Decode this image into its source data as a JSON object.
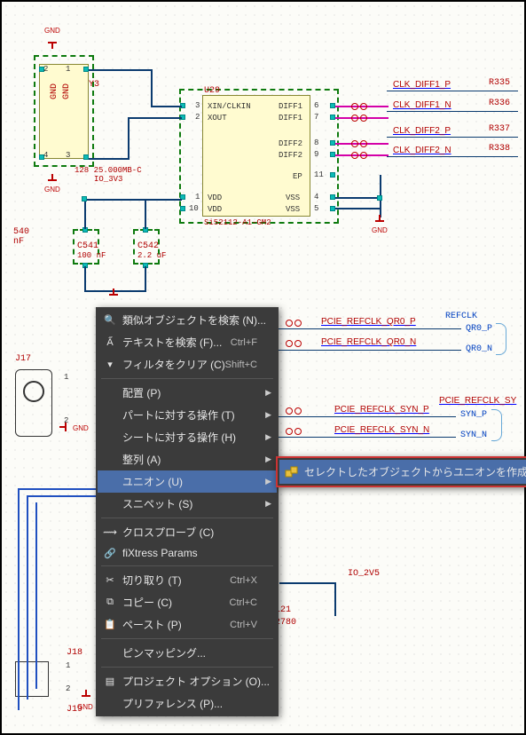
{
  "schematic": {
    "ic": {
      "ref": "U29",
      "part": "Si52112-A1-GM2",
      "pins_left": [
        "XIN/CLKIN",
        "XOUT",
        "VDD",
        "VDD"
      ],
      "pins_right": [
        "DIFF1",
        "DIFF1",
        "DIFF2",
        "DIFF2",
        "EP",
        "VSS",
        "VSS"
      ],
      "pin_nums_left": [
        "3",
        "2",
        "1",
        "10"
      ],
      "pin_nums_right": [
        "6",
        "7",
        "8",
        "9",
        "11",
        "4",
        "5"
      ]
    },
    "xtal": {
      "ref": "Y3",
      "value": "128 25.000MB-C"
    },
    "caps": {
      "c541_ref": "C541",
      "c541_val": "100 nF",
      "c542_ref": "C542",
      "c542_val": "2.2 uF"
    },
    "pwr": {
      "gnd": "GND",
      "io3v3": "IO_3V3",
      "io2v5": "IO_2V5"
    },
    "nets": {
      "d1p": "CLK_DIFF1_P",
      "d1n": "CLK_DIFF1_N",
      "d2p": "CLK_DIFF2_P",
      "d2n": "CLK_DIFF2_N",
      "q0": "PCIE_REFCLK_QR0_P",
      "q0n": "PCIE_REFCLK_QR0_N",
      "synp": "PCIE_REFCLK_SYN_P",
      "synn": "PCIE_REFCLK_SYN_N",
      "sylong": "PCIE_REFCLK_SY"
    },
    "resistors": {
      "r335": "R335",
      "r336": "R336",
      "r337": "R337",
      "r338": "R338"
    },
    "blue": {
      "refclk": "REFCLK",
      "qr0p": "QR0_P",
      "qr0n": "QR0_N",
      "synp": "SYN_P",
      "synn": "SYN_N"
    },
    "conns": {
      "j17": "J17",
      "j18": "J18",
      "j19": "J19"
    },
    "frag": {
      "nf": "540\nnF",
      "l21": "L21",
      "r2780": "2780"
    },
    "nums": {
      "p1": "1",
      "p2": "2",
      "p3": "3",
      "p4": "4"
    }
  },
  "menu": {
    "find_similar": "類似オブジェクトを検索 (N)...",
    "find_text": "テキストを検索 (F)...",
    "find_text_key": "Ctrl+F",
    "clear_filter": "フィルタをクリア (C)",
    "clear_filter_key": "Shift+C",
    "place": "配置 (P)",
    "part_ops": "パートに対する操作 (T)",
    "sheet_ops": "シートに対する操作 (H)",
    "align": "整列 (A)",
    "union": "ユニオン (U)",
    "snippet": "スニペット (S)",
    "crossprobe": "クロスプローブ (C)",
    "fixtress": "fiXtress Params",
    "cut": "切り取り (T)",
    "cut_key": "Ctrl+X",
    "copy": "コピー (C)",
    "copy_key": "Ctrl+C",
    "paste": "ペースト (P)",
    "paste_key": "Ctrl+V",
    "pinmap": "ピンマッピング...",
    "proj_opt": "プロジェクト オプション (O)...",
    "pref": "プリファレンス (P)..."
  },
  "submenu": {
    "create_union": "セレクトしたオブジェクトからユニオンを作成"
  }
}
